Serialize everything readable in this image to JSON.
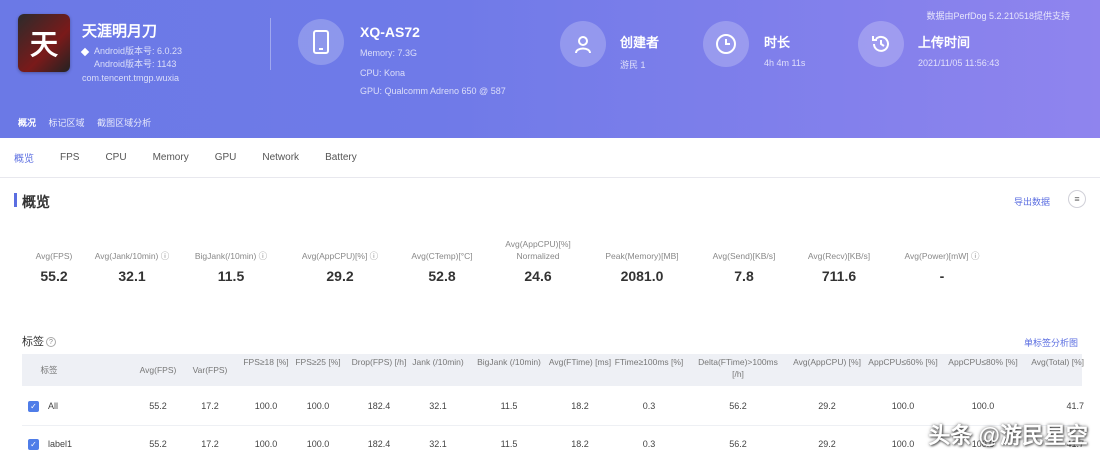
{
  "header": {
    "app_name": "天涯明月刀",
    "app_icon_glyph": "天",
    "app_meta": [
      "Android版本号: 6.0.23",
      "Android版本号: 1143",
      "com.tencent.tmgp.wuxia"
    ],
    "device_name": "XQ-AS72",
    "device_meta": [
      "Memory: 7.3G",
      "CPU: Kona",
      "GPU: Qualcomm Adreno 650 @ 587"
    ],
    "creator_label": "创建者",
    "creator_value": "游民 1",
    "duration_label": "时长",
    "duration_value": "4h 4m 11s",
    "upload_label": "上传时间",
    "upload_value": "2021/11/05 11:56:43",
    "top_right_note": "数据由PerfDog 5.2.210518提供支持",
    "breadcrumbs": [
      "概况",
      "标记区域",
      "截图区域分析"
    ]
  },
  "tabs": [
    "概览",
    "FPS",
    "CPU",
    "Memory",
    "GPU",
    "Network",
    "Battery"
  ],
  "overview": {
    "title": "概览",
    "link_label": "导出数据",
    "btn_glyph": "≡",
    "metrics": [
      {
        "label": "Avg(FPS)",
        "value": "55.2"
      },
      {
        "label": "Avg(Jank/10min) ⓘ",
        "value": "32.1"
      },
      {
        "label": "BigJank(/10min) ⓘ",
        "value": "11.5"
      },
      {
        "label": "Avg(AppCPU)[%] ⓘ",
        "value": "29.2"
      },
      {
        "label": "Avg(CTemp)[°C]",
        "value": "52.8"
      },
      {
        "label": "Avg(AppCPU)[%] Normalized",
        "value": "24.6"
      },
      {
        "label": "Peak(Memory)[MB]",
        "value": "2081.0"
      },
      {
        "label": "Avg(Send)[KB/s]",
        "value": "7.8"
      },
      {
        "label": "Avg(Recv)[KB/s]",
        "value": "711.6"
      },
      {
        "label": "Avg(Power)[mW] ⓘ",
        "value": "-"
      }
    ]
  },
  "labels_section": {
    "title": "标签",
    "link_label": "单标签分析图",
    "columns": [
      "标签",
      "Avg(FPS)",
      "Var(FPS)",
      "FPS≥18 [%]",
      "FPS≥25 [%]",
      "Drop(FPS) [/h]",
      "Jank (/10min)",
      "BigJank (/10min)",
      "Avg(FTime) [ms]",
      "FTime≥100ms [%]",
      "Delta(FTime)>100ms [/h]",
      "Avg(AppCPU) [%]",
      "AppCPU≤60% [%]",
      "AppCPU≤80% [%]",
      "Avg(Total) [%]"
    ],
    "rows": [
      {
        "name": "All",
        "cells": [
          "55.2",
          "17.2",
          "100.0",
          "100.0",
          "182.4",
          "32.1",
          "11.5",
          "18.2",
          "0.3",
          "56.2",
          "29.2",
          "100.0",
          "100.0",
          "41.7"
        ]
      },
      {
        "name": "label1",
        "cells": [
          "55.2",
          "17.2",
          "100.0",
          "100.0",
          "182.4",
          "32.1",
          "11.5",
          "18.2",
          "0.3",
          "56.2",
          "29.2",
          "100.0",
          "100.0",
          "41.7"
        ]
      }
    ]
  },
  "watermark": "头条 @游民星空",
  "colors": {
    "accent": "#5b6ee1",
    "banner_start": "#6b79e6",
    "banner_end": "#8f84ee",
    "checkbox": "#4f7de8"
  }
}
